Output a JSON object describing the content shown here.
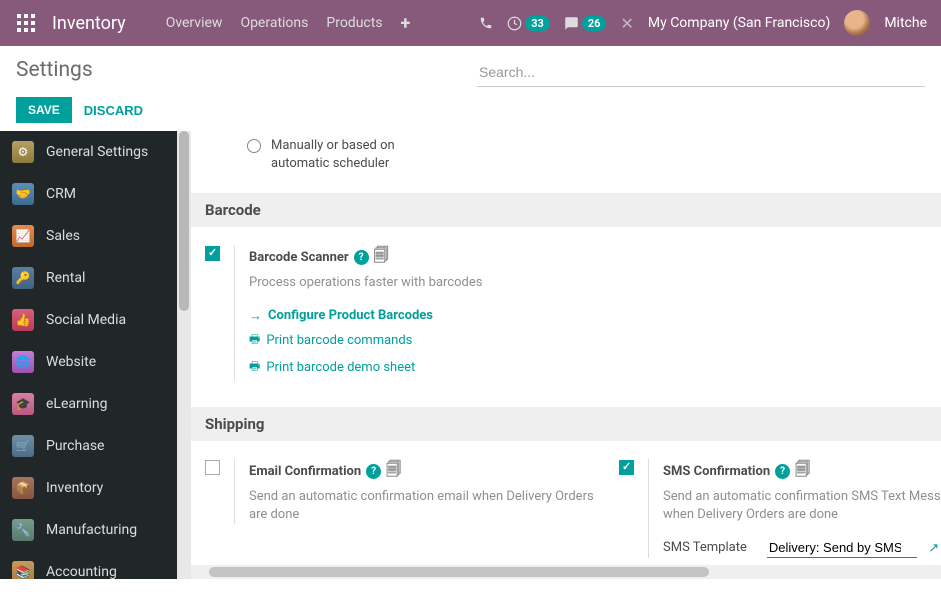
{
  "topbar": {
    "app_title": "Inventory",
    "nav": [
      "Overview",
      "Operations",
      "Products"
    ],
    "msg_badge": "33",
    "chat_badge": "26",
    "company": "My Company (San Francisco)",
    "user": "Mitche"
  },
  "page": {
    "title": "Settings",
    "search_placeholder": "Search...",
    "save": "SAVE",
    "discard": "DISCARD"
  },
  "sidebar": [
    {
      "label": "General Settings",
      "icon": "ic-gear"
    },
    {
      "label": "CRM",
      "icon": "ic-crm"
    },
    {
      "label": "Sales",
      "icon": "ic-sales"
    },
    {
      "label": "Rental",
      "icon": "ic-rental"
    },
    {
      "label": "Social Media",
      "icon": "ic-social"
    },
    {
      "label": "Website",
      "icon": "ic-website"
    },
    {
      "label": "eLearning",
      "icon": "ic-elearn"
    },
    {
      "label": "Purchase",
      "icon": "ic-purchase"
    },
    {
      "label": "Inventory",
      "icon": "ic-inventory"
    },
    {
      "label": "Manufacturing",
      "icon": "ic-mfg"
    },
    {
      "label": "Accounting",
      "icon": "ic-acct"
    }
  ],
  "scheduler": {
    "option": "Manually or based on automatic scheduler"
  },
  "sections": {
    "barcode": {
      "header": "Barcode",
      "title": "Barcode Scanner",
      "desc": "Process operations faster with barcodes",
      "links": {
        "configure": "Configure Product Barcodes",
        "print_cmd": "Print barcode commands",
        "print_demo": "Print barcode demo sheet"
      }
    },
    "shipping": {
      "header": "Shipping",
      "email": {
        "title": "Email Confirmation",
        "desc": "Send an automatic confirmation email when Delivery Orders are done"
      },
      "sms": {
        "title": "SMS Confirmation",
        "desc": "Send an automatic confirmation SMS Text Message when Delivery Orders are done",
        "tmpl_label": "SMS Template",
        "tmpl_value": "Delivery: Send by SMS T"
      }
    }
  }
}
